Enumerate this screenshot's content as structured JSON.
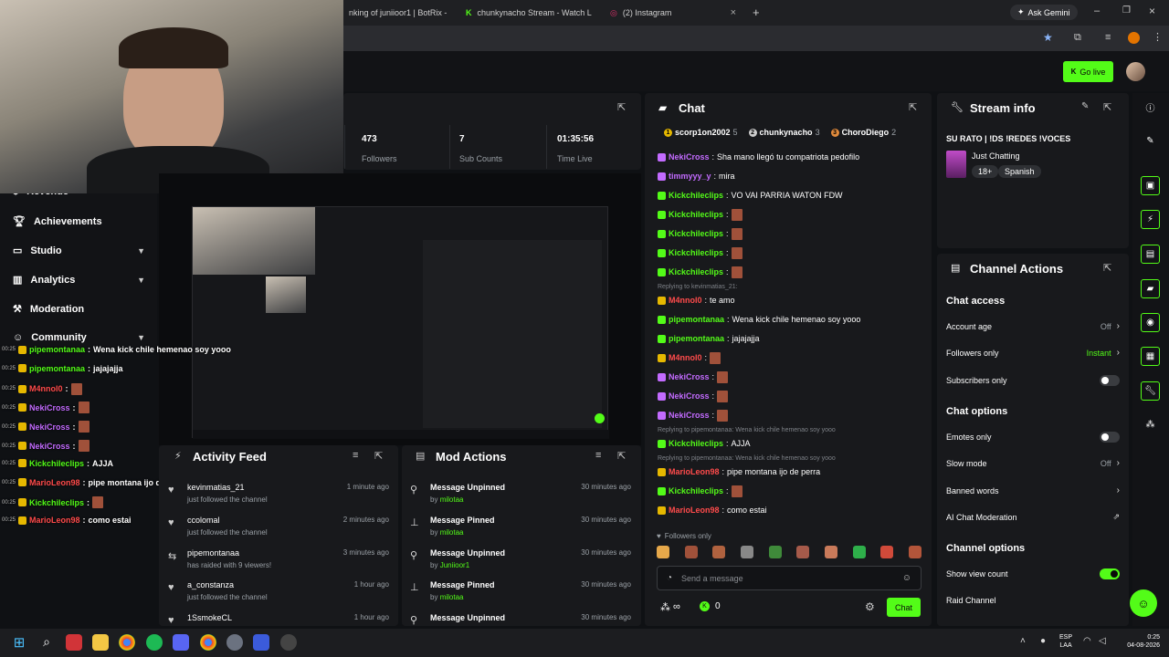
{
  "browser": {
    "tabs": [
      {
        "label": "nking of juniioor1 | BotRix -"
      },
      {
        "label": "chunkynacho Stream - Watch L"
      },
      {
        "label": "(2) Instagram"
      }
    ],
    "ask_gemini": "Ask Gemini"
  },
  "header": {
    "go_live": "Go live"
  },
  "stats": [
    {
      "value": "473",
      "label": "Followers"
    },
    {
      "value": "7",
      "label": "Sub Counts"
    },
    {
      "value": "01:35:56",
      "label": "Time Live"
    }
  ],
  "sidebar": {
    "items": [
      {
        "label": "Revenue"
      },
      {
        "label": "Achievements"
      },
      {
        "label": "Studio"
      },
      {
        "label": "Analytics"
      },
      {
        "label": "Moderation"
      },
      {
        "label": "Community"
      }
    ]
  },
  "overlay_chat": [
    {
      "time": "00:25",
      "user": "pipemontanaa",
      "color": "#53fc18",
      "text": "Wena kick chile hemenao soy yooo"
    },
    {
      "time": "00:25",
      "user": "pipemontanaa",
      "color": "#53fc18",
      "text": "jajajajja"
    },
    {
      "time": "00:25",
      "user": "M4nnol0",
      "color": "#ff4b4b",
      "text": ""
    },
    {
      "time": "00:25",
      "user": "NekiCross",
      "color": "#c36bff",
      "text": ""
    },
    {
      "time": "00:25",
      "user": "NekiCross",
      "color": "#c36bff",
      "text": ""
    },
    {
      "time": "00:25",
      "user": "NekiCross",
      "color": "#c36bff",
      "text": ""
    },
    {
      "time": "00:25",
      "user": "Kickchileclips",
      "color": "#53fc18",
      "text": "AJJA"
    },
    {
      "time": "00:25",
      "user": "MarioLeon98",
      "color": "#ff4b4b",
      "text": "pipe montana ijo de perra"
    },
    {
      "time": "00:25",
      "user": "Kickchileclips",
      "color": "#53fc18",
      "text": ""
    },
    {
      "time": "00:25",
      "user": "MarioLeon98",
      "color": "#ff4b4b",
      "text": "como estai"
    }
  ],
  "activity_feed": {
    "title": "Activity Feed",
    "rows": [
      {
        "name": "kevinmatias_21",
        "sub": "just followed the channel",
        "time": "1 minute ago",
        "icon": "heart-icon"
      },
      {
        "name": "ccolomal",
        "sub": "just followed the channel",
        "time": "2 minutes ago",
        "icon": "heart-icon"
      },
      {
        "name": "pipemontanaa",
        "sub": "has raided with 9 viewers!",
        "time": "3 minutes ago",
        "icon": "raid-icon"
      },
      {
        "name": "a_constanza",
        "sub": "just followed the channel",
        "time": "1 hour ago",
        "icon": "heart-icon"
      },
      {
        "name": "1SsmokeCL",
        "sub": "",
        "time": "1 hour ago",
        "icon": "heart-icon"
      }
    ]
  },
  "mod_actions": {
    "title": "Mod Actions",
    "rows": [
      {
        "action": "Message Unpinned",
        "by": "by",
        "mod": "milotaa",
        "time": "30 minutes ago"
      },
      {
        "action": "Message Pinned",
        "by": "by",
        "mod": "milotaa",
        "time": "30 minutes ago"
      },
      {
        "action": "Message Unpinned",
        "by": "by",
        "mod": "Juniioor1",
        "time": "30 minutes ago"
      },
      {
        "action": "Message Pinned",
        "by": "by",
        "mod": "milotaa",
        "time": "30 minutes ago"
      },
      {
        "action": "Message Unpinned",
        "by": "",
        "mod": "",
        "time": "30 minutes ago"
      }
    ]
  },
  "chat": {
    "title": "Chat",
    "top_gifters": [
      {
        "name": "scorp1on2002",
        "count": "5"
      },
      {
        "name": "chunkynacho",
        "count": "3"
      },
      {
        "name": "ChoroDiego",
        "count": "2"
      }
    ],
    "messages": [
      {
        "user": "NekiCross",
        "color": "#c36bff",
        "text": "Sha mano llegó tu compatriota pedofilo",
        "reply": ""
      },
      {
        "user": "timmyyy_y",
        "color": "#c36bff",
        "text": "mira",
        "reply": ""
      },
      {
        "user": "Kickchileclips",
        "color": "#53fc18",
        "text": "VO VAI PARRIA WATON FDW",
        "reply": ""
      },
      {
        "user": "Kickchileclips",
        "color": "#53fc18",
        "text": "",
        "reply": ""
      },
      {
        "user": "Kickchileclips",
        "color": "#53fc18",
        "text": "",
        "reply": ""
      },
      {
        "user": "Kickchileclips",
        "color": "#53fc18",
        "text": "",
        "reply": ""
      },
      {
        "user": "Kickchileclips",
        "color": "#53fc18",
        "text": "",
        "reply": ""
      },
      {
        "user": "M4nnol0",
        "color": "#ff4b4b",
        "text": "te amo",
        "reply": "Replying to kevinmatias_21:"
      },
      {
        "user": "pipemontanaa",
        "color": "#53fc18",
        "text": "Wena kick chile hemenao soy yooo",
        "reply": ""
      },
      {
        "user": "pipemontanaa",
        "color": "#53fc18",
        "text": "jajajajja",
        "reply": ""
      },
      {
        "user": "M4nnol0",
        "color": "#ff4b4b",
        "text": "",
        "reply": ""
      },
      {
        "user": "NekiCross",
        "color": "#c36bff",
        "text": "",
        "reply": ""
      },
      {
        "user": "NekiCross",
        "color": "#c36bff",
        "text": "",
        "reply": ""
      },
      {
        "user": "NekiCross",
        "color": "#c36bff",
        "text": "",
        "reply": ""
      },
      {
        "user": "Kickchileclips",
        "color": "#53fc18",
        "text": "AJJA",
        "reply": "Replying to pipemontanaa: Wena kick chile hemenao soy yooo"
      },
      {
        "user": "MarioLeon98",
        "color": "#ff4b4b",
        "text": "pipe montana ijo de perra",
        "reply": "Replying to pipemontanaa: Wena kick chile hemenao soy yooo"
      },
      {
        "user": "Kickchileclips",
        "color": "#53fc18",
        "text": "",
        "reply": ""
      },
      {
        "user": "MarioLeon98",
        "color": "#ff4b4b",
        "text": "como estai",
        "reply": ""
      }
    ],
    "followers_only": "Followers only",
    "input_placeholder": "Send a message",
    "infinity": "∞",
    "kick_count": "0",
    "send_label": "Chat"
  },
  "stream_info": {
    "title": "Stream info",
    "stream_title": "SU RATO | !DS !REDES !VOCES",
    "category": "Just Chatting",
    "tags": [
      "18+",
      "Spanish"
    ]
  },
  "channel_actions": {
    "title": "Channel Actions",
    "chat_access_title": "Chat access",
    "account_age": {
      "label": "Account age",
      "value": "Off"
    },
    "followers_only": {
      "label": "Followers only",
      "value": "Instant"
    },
    "subscribers_only": {
      "label": "Subscribers only"
    },
    "chat_options_title": "Chat options",
    "emotes_only": {
      "label": "Emotes only"
    },
    "slow_mode": {
      "label": "Slow mode",
      "value": "Off"
    },
    "banned_words": {
      "label": "Banned words"
    },
    "ai_moderation": {
      "label": "AI Chat Moderation"
    },
    "channel_options_title": "Channel options",
    "show_view_count": {
      "label": "Show view count"
    },
    "raid_channel": {
      "label": "Raid Channel"
    }
  },
  "taskbar": {
    "lang": "ESP",
    "region": "LAA",
    "time": "0:25",
    "date": "04-08-2026"
  },
  "colors": {
    "kick_green": "#53fc18",
    "panel": "#18191c",
    "bg": "#0f1114"
  }
}
